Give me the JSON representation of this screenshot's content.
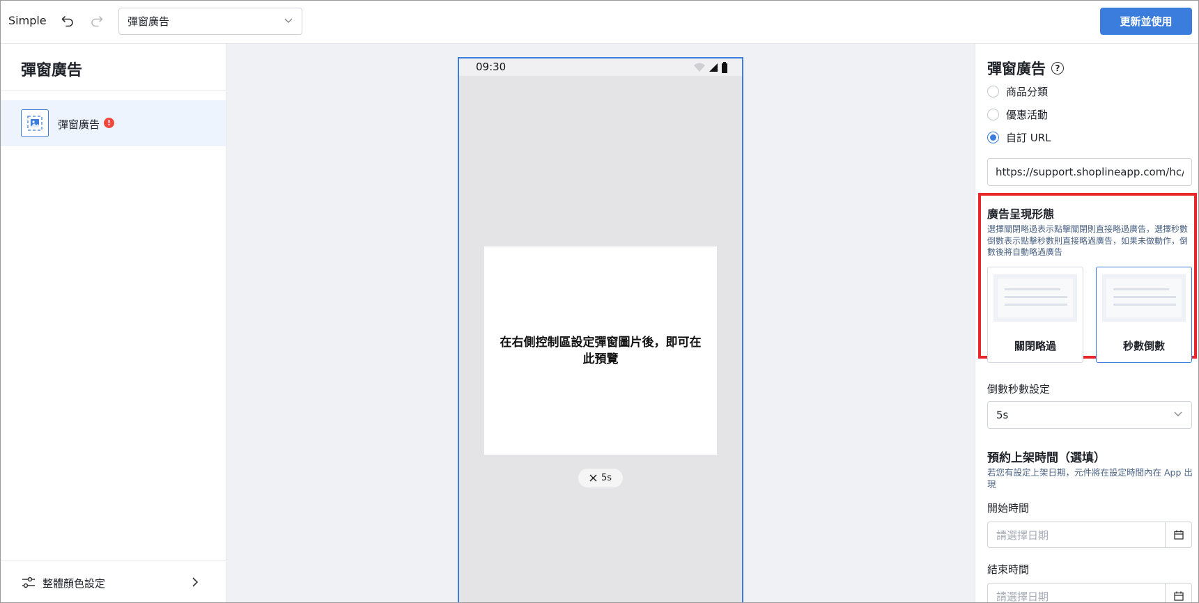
{
  "topbar": {
    "app_name": "Simple",
    "page_select_value": "彈窗廣告",
    "update_button": "更新並使用"
  },
  "left": {
    "title": "彈窗廣告",
    "component_label": "彈窗廣告",
    "error_badge": "!",
    "color_settings": "整體顏色設定"
  },
  "phone": {
    "time": "09:30",
    "popup_text": "在右側控制區設定彈窗圖片後，即可在此預覽",
    "countdown_label": "5s"
  },
  "right": {
    "title": "彈窗廣告",
    "help": "?",
    "radios": [
      {
        "label": "商品分類",
        "checked": false
      },
      {
        "label": "優惠活動",
        "checked": false
      },
      {
        "label": "自訂 URL",
        "checked": true
      }
    ],
    "url_value": "https://support.shoplineapp.com/hc/zh",
    "style_title": "廣告呈現形態",
    "style_desc": "選擇關閉略過表示點擊關閉則直接略過廣告，選擇秒數倒數表示點擊秒數則直接略過廣告，如果未做動作，倒數後將自動略過廣告",
    "style_options": [
      {
        "label": "關閉略過",
        "selected": false
      },
      {
        "label": "秒數倒數",
        "selected": true
      }
    ],
    "countdown_label": "倒數秒數設定",
    "countdown_value": "5s",
    "schedule_title": "預約上架時間（選填）",
    "schedule_desc": "若您有設定上架日期，元件將在設定時間內在 App 出現",
    "start_label": "開始時間",
    "start_placeholder": "請選擇日期",
    "end_label": "結束時間",
    "end_placeholder": "請選擇日期"
  },
  "colors": {
    "accent": "#3b7ddd",
    "highlight": "#e8262b",
    "error": "#f0483e"
  }
}
